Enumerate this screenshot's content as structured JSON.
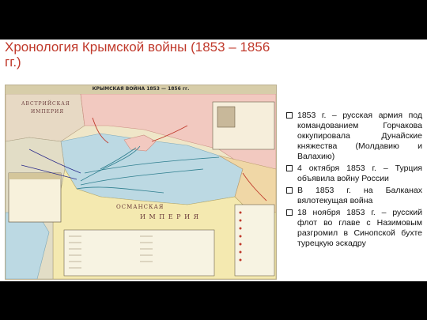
{
  "slide": {
    "title": "Хронология Крымской войны (1853 – 1856 гг.)"
  },
  "map": {
    "header_title": "КРЫМСКАЯ ВОЙНА 1853 — 1856 гг.",
    "labels": {
      "austria": "АВСТРИЙСКАЯ",
      "empire": "ИМПЕРИЯ",
      "ottoman": "ОСМАНСКАЯ",
      "imperia": "И М П Е Р И Я"
    }
  },
  "bullets": [
    "1853 г. – русская армия под командованием Горчакова оккупировала Дунайские княжества (Молдавию и Валахию)",
    "4 октября 1853 г. – Турция объявила войну России",
    "В 1853 г. на Балканах вялотекущая война",
    "18 ноября 1853 г. – русский флот во главе с Назимовым разгромил в Синопской бухте турецкую эскадру"
  ],
  "colors": {
    "background": "#000000",
    "slide": "#ffffff",
    "title": "#c0392b",
    "sea": "#bcd9e3",
    "russia": "#f2c9c0",
    "ottoman": "#f4e9b0",
    "austria": "#e7d9c4"
  }
}
